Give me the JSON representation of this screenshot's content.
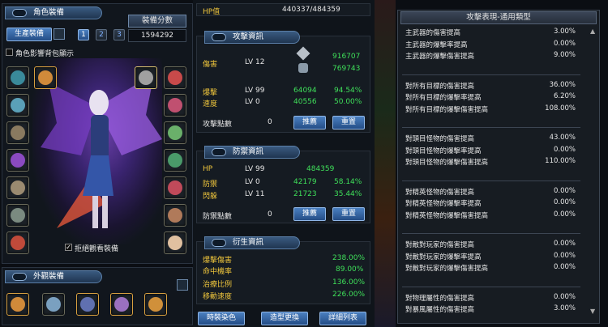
{
  "left": {
    "title": "角色裝備",
    "produce_btn": "生產裝備",
    "preset_1": "1",
    "preset_2": "2",
    "preset_3": "3",
    "score_label": "裝備分數",
    "score_value": "1594292",
    "show_back_checkbox": "角色影響背包顯示",
    "refuse_view_checkbox": "拒絕觀看裝備",
    "appearance_title": "外觀裝備"
  },
  "middle": {
    "hp_label": "HP值",
    "hp_value": "440337/484359",
    "attack": {
      "title": "攻擊資訊",
      "damage_label": "傷害",
      "damage_lv": "LV 12",
      "damage_val1": "916707",
      "damage_val2": "769743",
      "crit_label": "爆擊",
      "crit_lv": "LV 99",
      "crit_val": "64094",
      "crit_pct": "94.54%",
      "speed_label": "速度",
      "speed_lv": "LV 0",
      "speed_val": "40556",
      "speed_pct": "50.00%",
      "points_label": "攻擊點數",
      "points_val": "0",
      "recommend_btn": "推薦",
      "reset_btn": "重置"
    },
    "defense": {
      "title": "防禦資訊",
      "hp_label": "HP",
      "hp_lv": "LV 99",
      "hp_val": "484359",
      "def_label": "防禦",
      "def_lv": "LV 0",
      "def_val": "42179",
      "def_pct": "58.14%",
      "dodge_label": "閃躲",
      "dodge_lv": "LV 11",
      "dodge_val": "21723",
      "dodge_pct": "35.44%",
      "points_label": "防禦點數",
      "points_val": "0",
      "recommend_btn": "推薦",
      "reset_btn": "重置"
    },
    "derived": {
      "title": "衍生資訊",
      "rows": [
        {
          "label": "爆擊傷害",
          "value": "238.00%"
        },
        {
          "label": "命中機率",
          "value": "89.00%"
        },
        {
          "label": "治療比例",
          "value": "136.00%"
        },
        {
          "label": "移動速度",
          "value": "226.00%"
        }
      ]
    },
    "bottom_buttons": [
      "時裝染色",
      "造型更換",
      "詳細列表"
    ]
  },
  "right": {
    "title": "攻擊表現-通用類型",
    "groups": [
      [
        {
          "label": "主武器的傷害提高",
          "value": "3.00%"
        },
        {
          "label": "主武器的爆擊率提高",
          "value": "0.00%"
        },
        {
          "label": "主武器的爆擊傷害提高",
          "value": "9.00%"
        }
      ],
      [
        {
          "label": "對所有目標的傷害提高",
          "value": "36.00%"
        },
        {
          "label": "對所有目標的爆擊率提高",
          "value": "6.20%"
        },
        {
          "label": "對所有目標的爆擊傷害提高",
          "value": "108.00%"
        }
      ],
      [
        {
          "label": "對頭目怪物的傷害提高",
          "value": "43.00%"
        },
        {
          "label": "對頭目怪物的爆擊率提高",
          "value": "0.00%"
        },
        {
          "label": "對頭目怪物的爆擊傷害提高",
          "value": "110.00%"
        }
      ],
      [
        {
          "label": "對精英怪物的傷害提高",
          "value": "0.00%"
        },
        {
          "label": "對精英怪物的爆擊率提高",
          "value": "0.00%"
        },
        {
          "label": "對精英怪物的爆擊傷害提高",
          "value": "0.00%"
        }
      ],
      [
        {
          "label": "對敵對玩家的傷害提高",
          "value": "0.00%"
        },
        {
          "label": "對敵對玩家的爆擊率提高",
          "value": "0.00%"
        },
        {
          "label": "對敵對玩家的爆擊傷害提高",
          "value": "0.00%"
        }
      ],
      [
        {
          "label": "對物理屬性的傷害提高",
          "value": "0.00%"
        },
        {
          "label": "對暴風屬性的傷害提高",
          "value": "3.00%"
        }
      ]
    ]
  }
}
